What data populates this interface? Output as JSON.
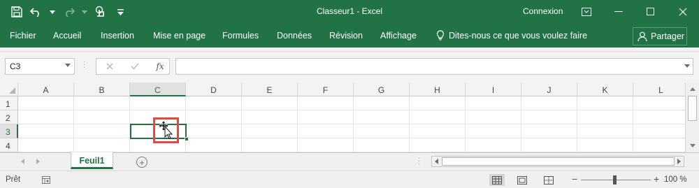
{
  "window": {
    "title": "Classeur1 - Excel",
    "signin": "Connexion"
  },
  "quick_access": {
    "icons": [
      "save-icon",
      "undo-icon",
      "redo-icon",
      "touch-mode-icon",
      "customize-qat-icon"
    ]
  },
  "ribbon": {
    "tabs": [
      "Fichier",
      "Accueil",
      "Insertion",
      "Mise en page",
      "Formules",
      "Données",
      "Révision",
      "Affichage"
    ],
    "tell_me": "Dites-nous ce que vous voulez faire",
    "share": "Partager"
  },
  "formula_bar": {
    "name_box": "C3",
    "fx_label": "fx",
    "formula": ""
  },
  "grid": {
    "columns": [
      "A",
      "B",
      "C",
      "D",
      "E",
      "F",
      "G",
      "H",
      "I",
      "J",
      "K",
      "L"
    ],
    "rows": [
      "1",
      "2",
      "3",
      "4"
    ],
    "selected_column": "C",
    "selected_row": "3",
    "active_cell": "C3"
  },
  "sheets": {
    "tabs": [
      "Feuil1"
    ],
    "active": "Feuil1"
  },
  "status": {
    "mode": "Prêt",
    "zoom": "100 %"
  },
  "colors": {
    "accent": "#217346",
    "highlight": "#e04a3f"
  }
}
